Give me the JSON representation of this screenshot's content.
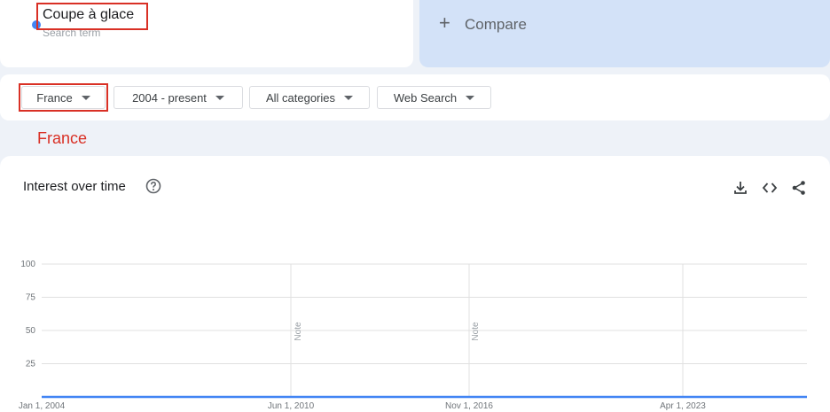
{
  "search": {
    "term": "Coupe à glace",
    "placeholder": "Search term",
    "term_color": "#4285f4",
    "compare_label": "Compare",
    "compare_icon": "plus-icon"
  },
  "filters": [
    {
      "label": "France"
    },
    {
      "label": "2004 - present"
    },
    {
      "label": "All categories"
    },
    {
      "label": "Web Search"
    }
  ],
  "annotation": {
    "text": "France",
    "color": "#d93025"
  },
  "interest": {
    "title": "Interest over time",
    "icons": [
      "help-icon",
      "download-icon",
      "embed-icon",
      "share-icon"
    ]
  },
  "chart_data": {
    "type": "line",
    "title": "Interest over time",
    "ylim": [
      0,
      100
    ],
    "yticks": [
      100,
      75,
      50,
      25
    ],
    "xtick_labels": [
      "Jan 1, 2004",
      "Jun 1, 2010",
      "Nov 1, 2016",
      "Apr 1, 2023"
    ],
    "notes": [
      "Note",
      "Note"
    ],
    "grid": true,
    "series_color": "#4285f4",
    "series": [
      {
        "values": [
          0,
          0,
          0,
          0,
          0,
          0,
          0,
          0,
          0,
          0,
          0,
          0,
          0,
          0,
          0,
          0,
          0,
          0,
          0,
          0,
          0,
          0,
          0,
          0,
          0,
          0,
          0,
          0,
          0,
          0,
          0,
          0,
          0,
          0,
          0,
          0,
          0,
          0,
          0,
          0,
          0,
          0,
          0,
          0,
          0,
          0,
          0,
          0,
          0,
          0,
          0,
          0,
          0,
          0,
          0,
          0,
          0,
          0,
          0,
          0,
          0,
          0,
          0,
          0,
          0,
          0,
          0,
          0,
          0,
          0,
          0,
          0,
          0,
          0,
          0,
          0,
          0,
          0,
          0,
          0,
          0,
          0,
          0,
          0,
          0,
          0,
          0,
          0,
          0,
          0,
          0,
          0,
          0,
          0,
          0,
          0,
          0,
          0,
          0,
          0,
          0,
          0,
          0,
          0,
          0,
          0,
          0,
          0,
          0,
          0,
          0,
          0,
          0,
          0,
          0,
          0,
          0,
          0,
          0,
          0,
          0,
          0,
          0,
          0,
          0,
          0,
          0,
          0,
          0,
          0,
          0,
          0,
          0,
          0,
          0,
          0,
          0,
          0,
          0,
          0,
          0,
          0,
          0,
          0,
          0,
          0,
          0,
          0,
          0,
          0,
          0,
          0,
          0,
          0,
          0,
          0,
          0,
          0,
          0,
          0,
          0,
          0,
          0,
          0,
          0,
          0,
          0,
          0,
          0,
          0,
          0,
          0,
          0,
          0,
          0,
          0,
          0,
          0,
          0,
          0,
          0,
          0,
          0,
          0,
          0,
          0,
          0,
          0,
          0,
          0,
          0,
          0,
          0,
          0,
          0,
          0,
          0,
          0,
          0,
          0,
          0,
          0,
          0,
          0,
          0,
          0,
          0,
          0,
          0,
          0,
          0,
          0,
          0,
          0,
          0,
          0,
          0,
          0,
          0,
          0,
          0,
          0,
          0,
          0,
          0,
          0,
          0,
          0,
          0,
          0,
          0,
          0,
          0,
          0,
          0,
          0,
          0,
          0,
          0,
          0,
          0,
          0,
          0,
          0,
          0,
          0,
          0,
          0,
          0,
          0,
          0,
          0,
          0,
          0,
          0,
          0,
          0,
          0,
          0,
          0,
          0,
          0,
          0,
          0,
          0,
          0,
          0,
          0,
          0,
          0,
          0,
          0,
          0,
          0,
          0,
          0,
          0,
          0,
          0,
          0,
          0,
          0,
          0,
          0,
          0,
          0,
          0,
          0
        ]
      }
    ]
  }
}
